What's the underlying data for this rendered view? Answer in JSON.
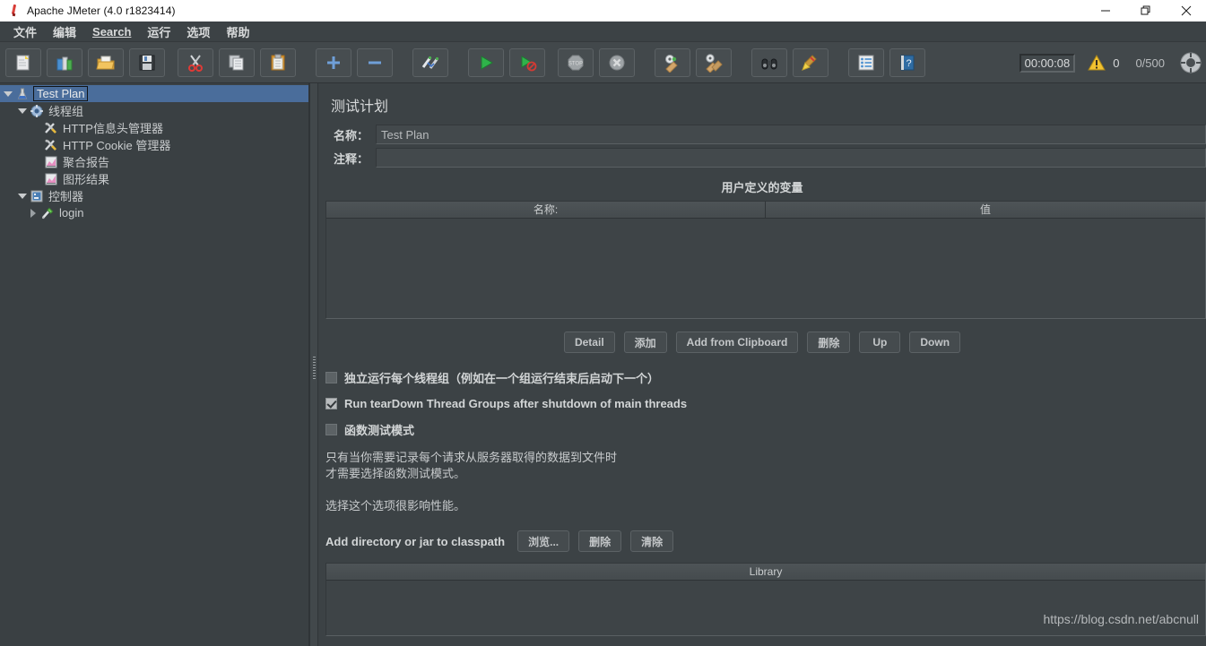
{
  "window": {
    "title": "Apache JMeter (4.0 r1823414)",
    "app_icon": "jmeter-pen-icon",
    "controls": {
      "minimize": "minimize-icon",
      "maximize": "maximize-icon",
      "close": "close-icon"
    }
  },
  "menubar": {
    "items": [
      {
        "label": "文件",
        "accel": ""
      },
      {
        "label": "编辑",
        "accel": ""
      },
      {
        "label": "Search",
        "accel": "S"
      },
      {
        "label": "运行",
        "accel": ""
      },
      {
        "label": "选项",
        "accel": ""
      },
      {
        "label": "帮助",
        "accel": ""
      }
    ]
  },
  "toolbar": {
    "buttons": [
      {
        "name": "new-button",
        "icon": "new-document-icon"
      },
      {
        "name": "templates-button",
        "icon": "templates-books-icon"
      },
      {
        "name": "open-button",
        "icon": "open-folder-icon"
      },
      {
        "name": "save-button",
        "icon": "save-floppy-icon"
      },
      {
        "name": "cut-button",
        "icon": "cut-scissors-icon"
      },
      {
        "name": "copy-button",
        "icon": "copy-pages-icon"
      },
      {
        "name": "paste-button",
        "icon": "paste-clipboard-icon"
      },
      {
        "name": "expand-all-button",
        "icon": "plus-icon"
      },
      {
        "name": "collapse-all-button",
        "icon": "minus-icon"
      },
      {
        "name": "toggle-button",
        "icon": "toggle-pencils-icon"
      },
      {
        "name": "start-button",
        "icon": "play-green-icon"
      },
      {
        "name": "start-no-pauses-button",
        "icon": "play-no-pause-icon"
      },
      {
        "name": "stop-button",
        "icon": "stop-sign-icon"
      },
      {
        "name": "shutdown-button",
        "icon": "shutdown-x-icon"
      },
      {
        "name": "clear-button",
        "icon": "clear-broom-icon"
      },
      {
        "name": "clear-all-button",
        "icon": "clear-all-broom-icon"
      },
      {
        "name": "search-button",
        "icon": "binoculars-icon"
      },
      {
        "name": "reset-search-button",
        "icon": "reset-broom-icon"
      },
      {
        "name": "function-helper-button",
        "icon": "function-helper-icon"
      },
      {
        "name": "help-button",
        "icon": "help-book-icon"
      },
      {
        "name": "remote-button",
        "icon": "remote-circle-icon"
      }
    ],
    "timer": "00:00:08",
    "warning_icon": "warning-triangle-icon",
    "warning_count": "0",
    "thread_count": "0/500"
  },
  "tree": {
    "nodes": [
      {
        "label": "Test Plan",
        "icon": "test-plan-icon",
        "indent": 0,
        "twist": "down",
        "selected": true
      },
      {
        "label": "线程组",
        "icon": "thread-group-icon",
        "indent": 1,
        "twist": "down",
        "selected": false
      },
      {
        "label": "HTTP信息头管理器",
        "icon": "header-manager-icon",
        "indent": 2,
        "twist": "none",
        "selected": false
      },
      {
        "label": "HTTP Cookie 管理器",
        "icon": "cookie-manager-icon",
        "indent": 2,
        "twist": "none",
        "selected": false
      },
      {
        "label": "聚合报告",
        "icon": "aggregate-report-icon",
        "indent": 2,
        "twist": "none",
        "selected": false
      },
      {
        "label": "图形结果",
        "icon": "graph-results-icon",
        "indent": 2,
        "twist": "none",
        "selected": false
      },
      {
        "label": "控制器",
        "icon": "controller-icon",
        "indent": 1,
        "twist": "down",
        "selected": false
      },
      {
        "label": "login",
        "icon": "sampler-icon",
        "indent": 2,
        "twist": "right",
        "selected": false
      }
    ]
  },
  "main": {
    "title": "测试计划",
    "fields": {
      "name_label": "名称：",
      "name_value": "Test Plan",
      "comment_label": "注释：",
      "comment_value": ""
    },
    "variables": {
      "section_title": "用户定义的变量",
      "columns": [
        "名称:",
        "值"
      ],
      "rows": []
    },
    "variable_buttons": [
      {
        "name": "detail-button",
        "label": "Detail"
      },
      {
        "name": "add-button",
        "label": "添加"
      },
      {
        "name": "add-from-clipboard-button",
        "label": "Add from Clipboard"
      },
      {
        "name": "delete-button",
        "label": "删除"
      },
      {
        "name": "up-button",
        "label": "Up"
      },
      {
        "name": "down-button",
        "label": "Down"
      }
    ],
    "checkboxes": [
      {
        "name": "run-thread-groups-consecutively",
        "label": "独立运行每个线程组（例如在一个组运行结束后启动下一个）",
        "checked": false
      },
      {
        "name": "run-teardown-thread-groups",
        "label": "Run tearDown Thread Groups after shutdown of main threads",
        "checked": true
      },
      {
        "name": "functional-test-mode",
        "label": "函数测试模式",
        "checked": false
      }
    ],
    "help_lines": [
      "只有当你需要记录每个请求从服务器取得的数据到文件时",
      "才需要选择函数测试模式。",
      "",
      "选择这个选项很影响性能。"
    ],
    "classpath": {
      "label": "Add directory or jar to classpath",
      "buttons": [
        {
          "name": "browse-button",
          "label": "浏览..."
        },
        {
          "name": "classpath-delete-button",
          "label": "删除"
        },
        {
          "name": "classpath-clear-button",
          "label": "清除"
        }
      ],
      "table_header": "Library",
      "rows": []
    },
    "watermark": "https://blog.csdn.net/abcnull"
  },
  "colors": {
    "window_bg": "#3c4245",
    "toolbar_bg": "#42484b",
    "panel_bg": "#3a4043",
    "selection": "#4a6d9b",
    "text": "#d2d5d6",
    "titlebar_bg": "#ffffff"
  }
}
